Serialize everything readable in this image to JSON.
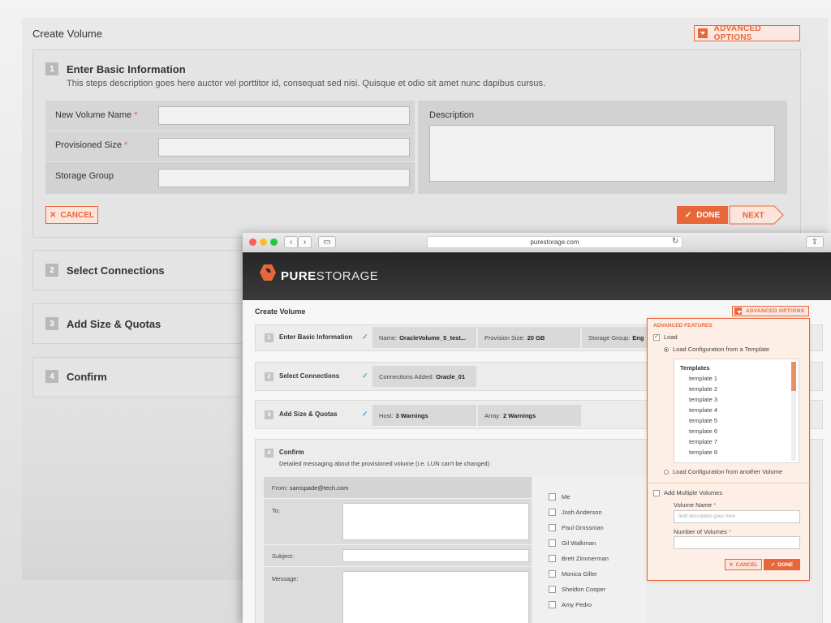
{
  "back": {
    "title": "Create Volume",
    "advanced_options": "ADVANCED OPTIONS",
    "steps": [
      {
        "num": "1",
        "title": "Enter Basic Information",
        "description": "This steps description goes here auctor vel porttitor id, consequat sed nisi. Quisque et odio sit amet nunc dapibus cursus."
      },
      {
        "num": "2",
        "title": "Select Connections"
      },
      {
        "num": "3",
        "title": "Add Size & Quotas"
      },
      {
        "num": "4",
        "title": "Confirm"
      }
    ],
    "fields": {
      "volume_name": "New Volume Name",
      "provisioned_size": "Provisioned Size",
      "storage_group": "Storage Group",
      "required": "*",
      "description": "Description"
    },
    "cancel": "CANCEL",
    "done": "DONE",
    "next": "NEXT"
  },
  "browser": {
    "url": "purestorage.com",
    "logo_bold": "PURE",
    "logo_light": "STORAGE",
    "title": "Create Volume",
    "advanced_options": "ADVANCED OPTIONS",
    "steps": [
      {
        "num": "1",
        "title": "Enter Basic Information",
        "check": "✓"
      },
      {
        "num": "2",
        "title": "Select Connections",
        "check": "✓"
      },
      {
        "num": "3",
        "title": "Add Size & Quotas",
        "check": "✓"
      },
      {
        "num": "4",
        "title": "Confirm",
        "description": "Detailed messaging about the provisioned volume (i.e. LUN can't be changed)"
      }
    ],
    "summary1": [
      {
        "label": "Name:",
        "value": "OracleVolume_5_test..."
      },
      {
        "label": "Provision Size:",
        "value": "20 GB"
      },
      {
        "label": "Storage Group:",
        "value": "Eng"
      }
    ],
    "summary2": {
      "label": "Connections Added:",
      "value": "Oracle_01"
    },
    "summary3": [
      {
        "label": "Host:",
        "value": "3 Warnings"
      },
      {
        "label": "Array:",
        "value": "2 Warnings"
      }
    ],
    "email": {
      "from_label": "From:",
      "from_value": "samspade@tech.com",
      "to": "To:",
      "subject": "Subject:",
      "message": "Message:"
    },
    "recipients": [
      "Me",
      "Josh Anderson",
      "Paul Grossman",
      "Gil Walkman",
      "Brett Zimmerman",
      "Monica Giller",
      "Sheldon Cooper",
      "Amy Pedro"
    ]
  },
  "advanced": {
    "heading": "ADVANCED FEATURES",
    "load": "Load",
    "load_template": "Load Configuration from a Template",
    "templates_title": "Templates",
    "templates": [
      "template 1",
      "template 2",
      "template 3",
      "template 4",
      "template 5",
      "template 6",
      "template 7",
      "template 8"
    ],
    "load_volume": "Load Configuration from another Volume",
    "add_multiple": "Add Multiple Volumes",
    "volume_name": "Volume Name",
    "volume_placeholder": "field description goes here",
    "number_of_volumes": "Number of Volumes",
    "required": "*",
    "cancel": "CANCEL",
    "done": "DONE"
  },
  "colors": {
    "accent": "#e8673a",
    "check": "#4a9fd8"
  }
}
